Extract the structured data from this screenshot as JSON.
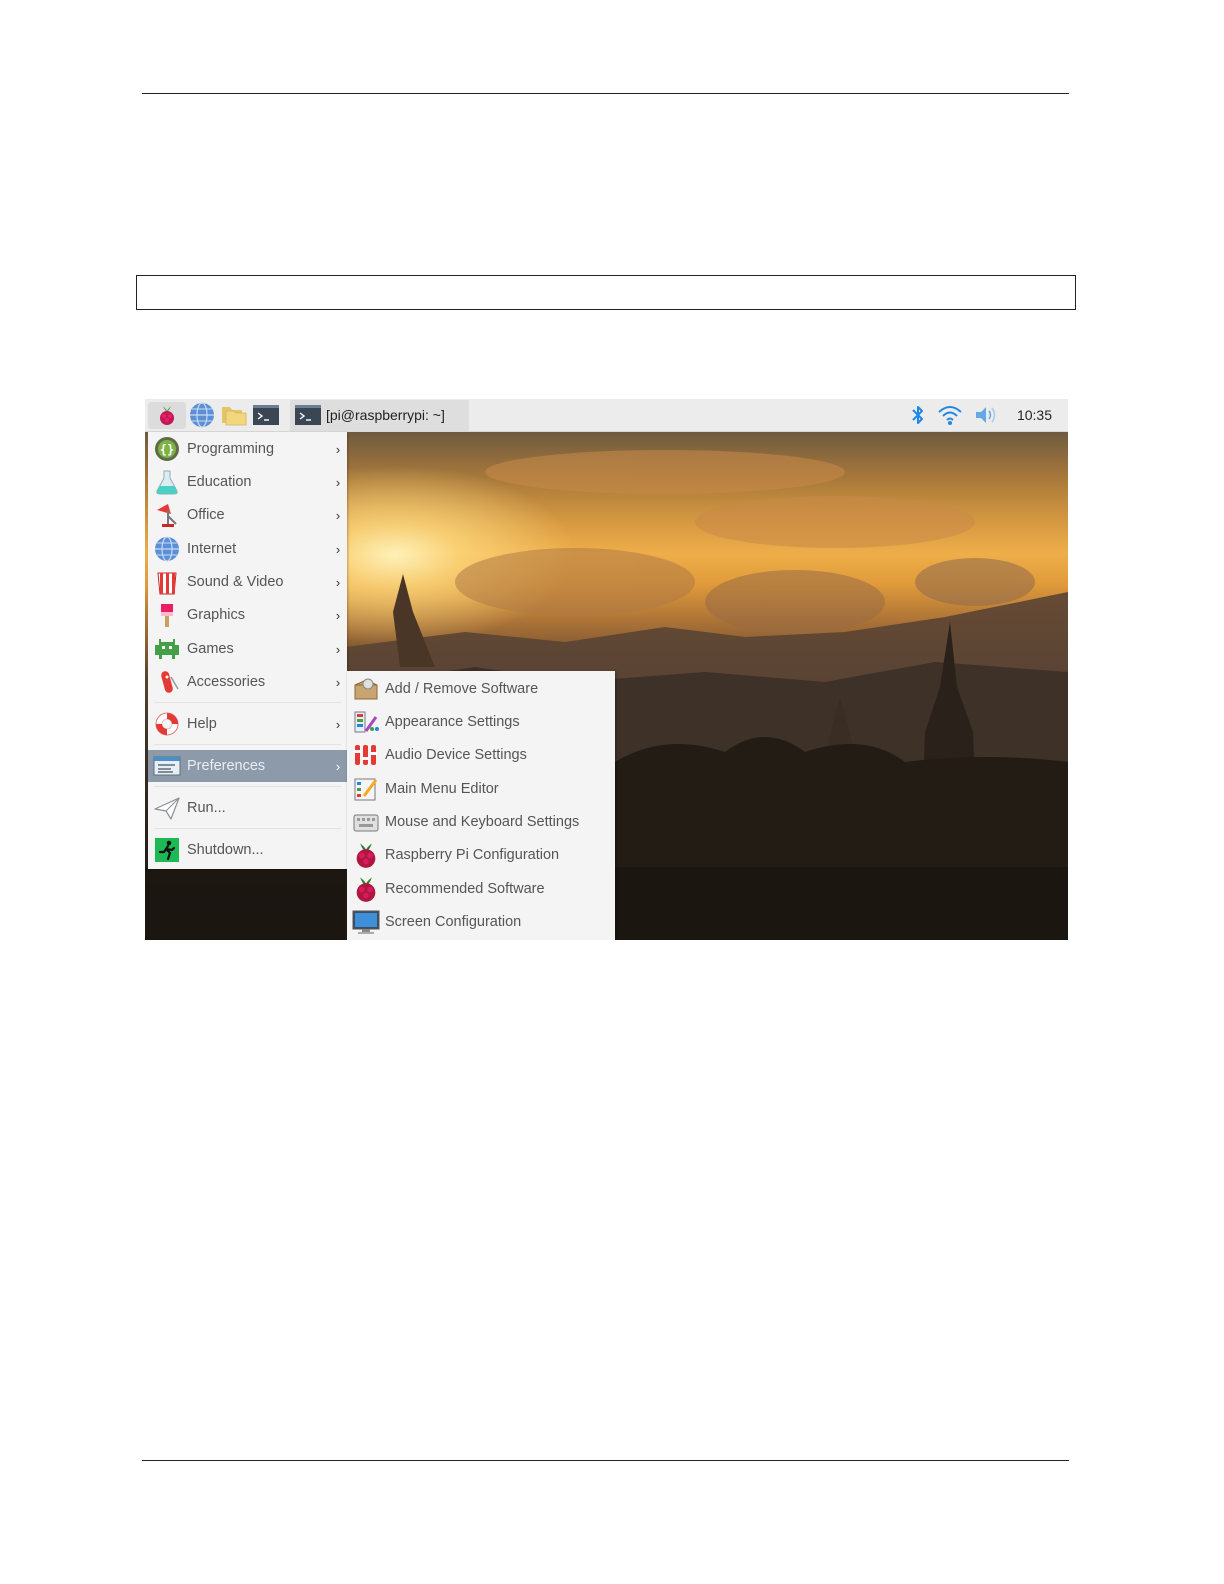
{
  "taskbar": {
    "window_title": "[pi@raspberrypi: ~]",
    "clock": "10:35"
  },
  "menu": {
    "items": [
      {
        "label": "Programming",
        "icon": "programming-icon",
        "arrow": "›"
      },
      {
        "label": "Education",
        "icon": "education-icon",
        "arrow": "›"
      },
      {
        "label": "Office",
        "icon": "office-icon",
        "arrow": "›"
      },
      {
        "label": "Internet",
        "icon": "internet-icon",
        "arrow": "›"
      },
      {
        "label": "Sound & Video",
        "icon": "sound-video-icon",
        "arrow": "›"
      },
      {
        "label": "Graphics",
        "icon": "graphics-icon",
        "arrow": "›"
      },
      {
        "label": "Games",
        "icon": "games-icon",
        "arrow": "›"
      },
      {
        "label": "Accessories",
        "icon": "accessories-icon",
        "arrow": "›"
      },
      {
        "label": "Help",
        "icon": "help-icon",
        "arrow": "›"
      },
      {
        "label": "Preferences",
        "icon": "preferences-icon",
        "arrow": "›",
        "active": true
      },
      {
        "label": "Run...",
        "icon": "run-icon"
      },
      {
        "label": "Shutdown...",
        "icon": "shutdown-icon"
      }
    ]
  },
  "submenu": {
    "items": [
      {
        "label": "Add / Remove Software",
        "icon": "package-icon"
      },
      {
        "label": "Appearance Settings",
        "icon": "appearance-icon"
      },
      {
        "label": "Audio Device Settings",
        "icon": "audio-mixer-icon"
      },
      {
        "label": "Main Menu Editor",
        "icon": "menu-editor-icon"
      },
      {
        "label": "Mouse and Keyboard Settings",
        "icon": "keyboard-mouse-icon"
      },
      {
        "label": "Raspberry Pi Configuration",
        "icon": "raspberry-icon"
      },
      {
        "label": "Recommended Software",
        "icon": "raspberry-icon"
      },
      {
        "label": "Screen Configuration",
        "icon": "monitor-icon"
      }
    ]
  },
  "colors": {
    "menu_bg": "#f4f4f4",
    "highlight": "#8c9aa9",
    "taskbar_bg": "#ececec",
    "bluetooth": "#1e88e5"
  }
}
